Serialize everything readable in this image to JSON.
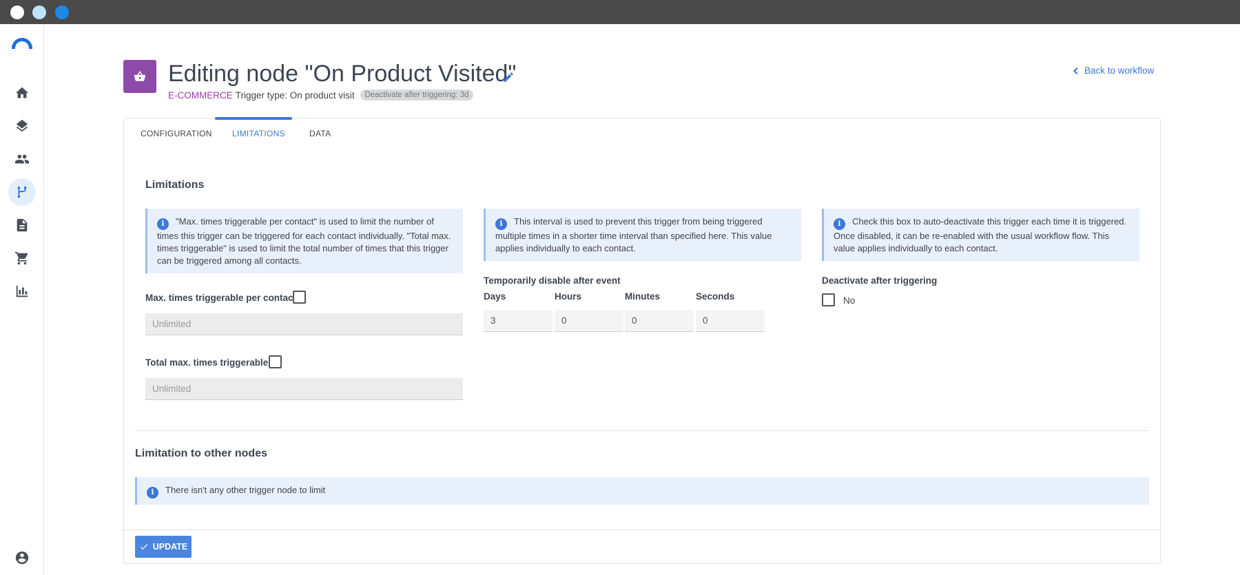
{
  "window": {
    "controls": [
      "close",
      "minimize",
      "maximize"
    ]
  },
  "sidebar": {
    "items": [
      {
        "icon": "home-icon"
      },
      {
        "icon": "layers-icon"
      },
      {
        "icon": "contacts-icon"
      },
      {
        "icon": "workflow-icon",
        "active": true
      },
      {
        "icon": "document-icon"
      },
      {
        "icon": "cart-icon"
      },
      {
        "icon": "chart-icon"
      }
    ],
    "bottom_icon": "account-icon"
  },
  "header": {
    "title": "Editing node \"On Product Visited\"",
    "category": "E-COMMERCE",
    "trigger_type": "Trigger type: On product visit",
    "badge": "Deactivate after triggering: 3d",
    "back_link": "Back to workflow"
  },
  "tabs": [
    {
      "label": "CONFIGURATION"
    },
    {
      "label": "LIMITATIONS",
      "active": true
    },
    {
      "label": "DATA"
    }
  ],
  "limitations": {
    "title": "Limitations",
    "info_max": "\"Max. times triggerable per contact\" is used to limit the number of times this trigger can be triggered for each contact individually. \"Total max. times triggerable\" is used to limit the total number of times that this trigger can be triggered among all contacts.",
    "info_interval": "This interval is used to prevent this trigger from being triggered multiple times in a shorter time interval than specified here. This value applies individually to each contact.",
    "info_deactivate": "Check this box to auto-deactivate this trigger each time it is triggered. Once disabled, it can be re-enabled with the usual workflow flow. This value applies individually to each contact.",
    "max_per_contact_label": "Max. times triggerable per contact",
    "max_per_contact_placeholder": "Unlimited",
    "total_max_label": "Total max. times triggerable",
    "total_max_placeholder": "Unlimited",
    "disable_label": "Temporarily disable after event",
    "days_label": "Days",
    "hours_label": "Hours",
    "minutes_label": "Minutes",
    "seconds_label": "Seconds",
    "days_value": "3",
    "hours_value": "0",
    "minutes_value": "0",
    "seconds_value": "0",
    "deactivate_label": "Deactivate after triggering",
    "deactivate_value": "No"
  },
  "other_nodes": {
    "title": "Limitation to other nodes",
    "info": "There isn't any other trigger node to limit"
  },
  "footer": {
    "update_label": "UPDATE"
  },
  "colors": {
    "accent": "#3a78d8",
    "category": "#9b3da6",
    "node_icon_bg": "#8e4aa8",
    "info_bg": "#e8f0fc"
  }
}
